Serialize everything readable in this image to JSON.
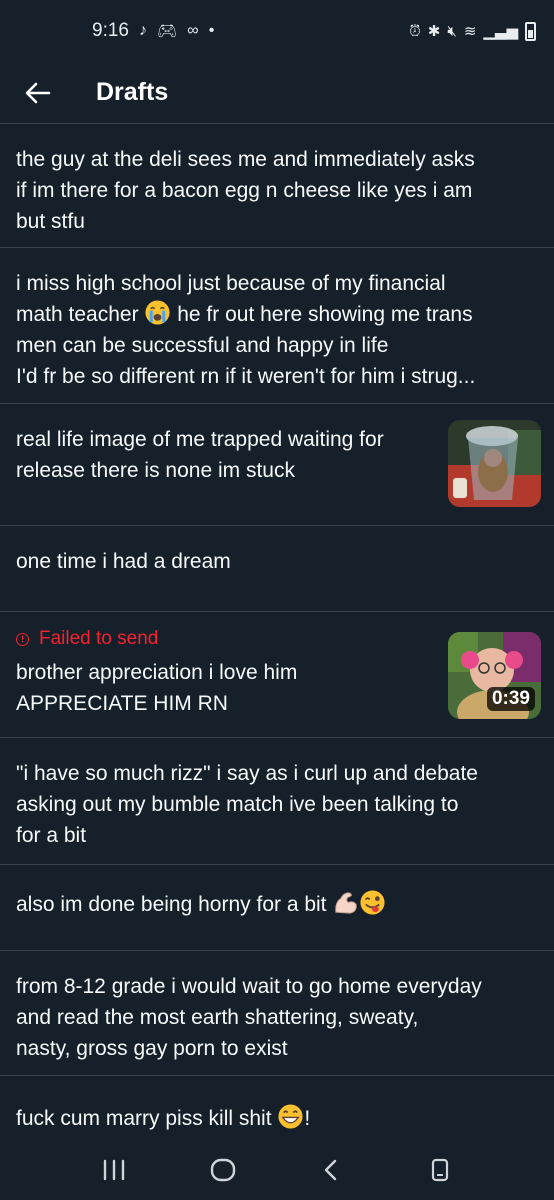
{
  "status_bar": {
    "time": "9:16"
  },
  "header": {
    "title": "Drafts"
  },
  "drafts": [
    {
      "text": "the guy at the deli sees me and immediately asks\nif im there for a bacon egg n cheese like yes i am\nbut stfu"
    },
    {
      "text_part1": "i miss high school just because of my financial\nmath teacher ",
      "text_part2": " he fr out here showing me trans\nmen can be successful and happy in life\nI'd fr be so different rn if it weren't for him i strug..."
    },
    {
      "text": "real life image of me trapped waiting for\nrelease there is none im stuck",
      "thumbnail": "image"
    },
    {
      "text": "one time i had a dream"
    },
    {
      "status": "Failed to send",
      "text": "brother appreciation i love him\nAPPRECIATE HIM RN",
      "thumbnail": "video",
      "duration": "0:39"
    },
    {
      "text": "\"i have so much rizz\" i say as i curl up and debate\nasking out my bumble match ive been talking to\nfor a bit"
    },
    {
      "text": "also im done being horny for a bit "
    },
    {
      "text": "from 8-12 grade i would wait to go home everyday\nand read the most earth shattering, sweaty,\nnasty, gross gay porn to exist"
    },
    {
      "text_part1": "fuck cum marry piss kill shit ",
      "text_part2": "!"
    }
  ],
  "colors": {
    "background": "#15202b",
    "divider": "#38444d",
    "error": "#f4212e"
  }
}
